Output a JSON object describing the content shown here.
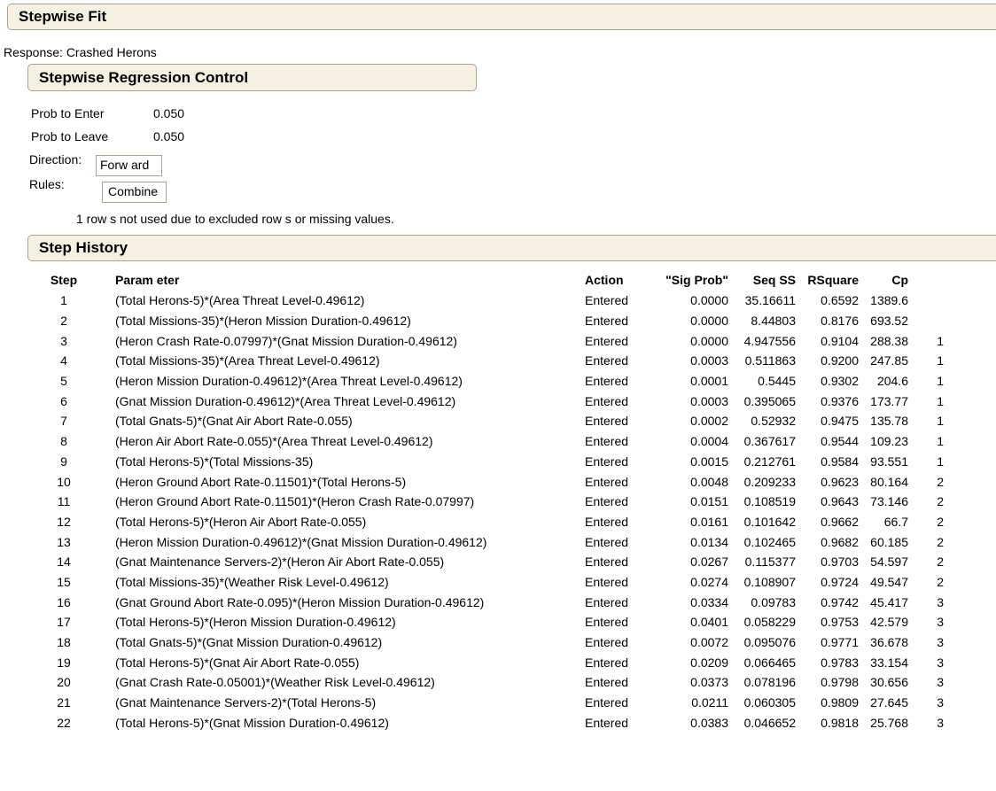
{
  "report": {
    "title": "Stepwise Fit",
    "response": "Response: Crashed Herons"
  },
  "control": {
    "title": "Stepwise Regression Control",
    "prob_enter_label": "Prob to Enter",
    "prob_enter_value": "0.050",
    "prob_leave_label": "Prob to Leave",
    "prob_leave_value": "0.050",
    "direction_label": "Direction:",
    "direction_value": "Forw ard",
    "rules_label": "Rules:",
    "rules_value": "Combine",
    "note": "1 row s not used due to excluded row s or missing values."
  },
  "history": {
    "title": "Step History",
    "columns": [
      "Step",
      "Param eter",
      "Action",
      "\"Sig Prob\"",
      "Seq SS",
      "RSquare",
      "Cp",
      ""
    ],
    "rows": [
      {
        "step": "1",
        "param": "(Total Herons-5)*(Area Threat Level-0.49612)",
        "action": "Entered",
        "sig": "0.0000",
        "seq": "35.16611",
        "rsq": "0.6592",
        "cp": "1389.6",
        "p": ""
      },
      {
        "step": "2",
        "param": "(Total Missions-35)*(Heron Mission Duration-0.49612)",
        "action": "Entered",
        "sig": "0.0000",
        "seq": "8.44803",
        "rsq": "0.8176",
        "cp": "693.52",
        "p": ""
      },
      {
        "step": "3",
        "param": "(Heron Crash Rate-0.07997)*(Gnat Mission Duration-0.49612)",
        "action": "Entered",
        "sig": "0.0000",
        "seq": "4.947556",
        "rsq": "0.9104",
        "cp": "288.38",
        "p": "1"
      },
      {
        "step": "4",
        "param": "(Total Missions-35)*(Area Threat Level-0.49612)",
        "action": "Entered",
        "sig": "0.0003",
        "seq": "0.511863",
        "rsq": "0.9200",
        "cp": "247.85",
        "p": "1"
      },
      {
        "step": "5",
        "param": "(Heron Mission Duration-0.49612)*(Area Threat Level-0.49612)",
        "action": "Entered",
        "sig": "0.0001",
        "seq": "0.5445",
        "rsq": "0.9302",
        "cp": "204.6",
        "p": "1"
      },
      {
        "step": "6",
        "param": "(Gnat Mission Duration-0.49612)*(Area Threat Level-0.49612)",
        "action": "Entered",
        "sig": "0.0003",
        "seq": "0.395065",
        "rsq": "0.9376",
        "cp": "173.77",
        "p": "1"
      },
      {
        "step": "7",
        "param": "(Total Gnats-5)*(Gnat Air Abort Rate-0.055)",
        "action": "Entered",
        "sig": "0.0002",
        "seq": "0.52932",
        "rsq": "0.9475",
        "cp": "135.78",
        "p": "1"
      },
      {
        "step": "8",
        "param": "(Heron Air Abort Rate-0.055)*(Area Threat Level-0.49612)",
        "action": "Entered",
        "sig": "0.0004",
        "seq": "0.367617",
        "rsq": "0.9544",
        "cp": "109.23",
        "p": "1"
      },
      {
        "step": "9",
        "param": "(Total Herons-5)*(Total Missions-35)",
        "action": "Entered",
        "sig": "0.0015",
        "seq": "0.212761",
        "rsq": "0.9584",
        "cp": "93.551",
        "p": "1"
      },
      {
        "step": "10",
        "param": "(Heron Ground Abort Rate-0.11501)*(Total Herons-5)",
        "action": "Entered",
        "sig": "0.0048",
        "seq": "0.209233",
        "rsq": "0.9623",
        "cp": "80.164",
        "p": "2"
      },
      {
        "step": "11",
        "param": "(Heron Ground Abort Rate-0.11501)*(Heron Crash Rate-0.07997)",
        "action": "Entered",
        "sig": "0.0151",
        "seq": "0.108519",
        "rsq": "0.9643",
        "cp": "73.146",
        "p": "2"
      },
      {
        "step": "12",
        "param": "(Total Herons-5)*(Heron Air Abort Rate-0.055)",
        "action": "Entered",
        "sig": "0.0161",
        "seq": "0.101642",
        "rsq": "0.9662",
        "cp": "66.7",
        "p": "2"
      },
      {
        "step": "13",
        "param": "(Heron Mission Duration-0.49612)*(Gnat Mission Duration-0.49612)",
        "action": "Entered",
        "sig": "0.0134",
        "seq": "0.102465",
        "rsq": "0.9682",
        "cp": "60.185",
        "p": "2"
      },
      {
        "step": "14",
        "param": "(Gnat Maintenance Servers-2)*(Heron Air Abort Rate-0.055)",
        "action": "Entered",
        "sig": "0.0267",
        "seq": "0.115377",
        "rsq": "0.9703",
        "cp": "54.597",
        "p": "2"
      },
      {
        "step": "15",
        "param": "(Total Missions-35)*(Weather Risk Level-0.49612)",
        "action": "Entered",
        "sig": "0.0274",
        "seq": "0.108907",
        "rsq": "0.9724",
        "cp": "49.547",
        "p": "2"
      },
      {
        "step": "16",
        "param": "(Gnat Ground Abort Rate-0.095)*(Heron Mission Duration-0.49612)",
        "action": "Entered",
        "sig": "0.0334",
        "seq": "0.09783",
        "rsq": "0.9742",
        "cp": "45.417",
        "p": "3"
      },
      {
        "step": "17",
        "param": "(Total Herons-5)*(Heron Mission Duration-0.49612)",
        "action": "Entered",
        "sig": "0.0401",
        "seq": "0.058229",
        "rsq": "0.9753",
        "cp": "42.579",
        "p": "3"
      },
      {
        "step": "18",
        "param": "(Total Gnats-5)*(Gnat Mission Duration-0.49612)",
        "action": "Entered",
        "sig": "0.0072",
        "seq": "0.095076",
        "rsq": "0.9771",
        "cp": "36.678",
        "p": "3"
      },
      {
        "step": "19",
        "param": "(Total Herons-5)*(Gnat Air Abort Rate-0.055)",
        "action": "Entered",
        "sig": "0.0209",
        "seq": "0.066465",
        "rsq": "0.9783",
        "cp": "33.154",
        "p": "3"
      },
      {
        "step": "20",
        "param": "(Gnat Crash Rate-0.05001)*(Weather Risk Level-0.49612)",
        "action": "Entered",
        "sig": "0.0373",
        "seq": "0.078196",
        "rsq": "0.9798",
        "cp": "30.656",
        "p": "3"
      },
      {
        "step": "21",
        "param": "(Gnat Maintenance Servers-2)*(Total Herons-5)",
        "action": "Entered",
        "sig": "0.0211",
        "seq": "0.060305",
        "rsq": "0.9809",
        "cp": "27.645",
        "p": "3"
      },
      {
        "step": "22",
        "param": "(Total Herons-5)*(Gnat Mission Duration-0.49612)",
        "action": "Entered",
        "sig": "0.0383",
        "seq": "0.046652",
        "rsq": "0.9818",
        "cp": "25.768",
        "p": "3"
      }
    ]
  }
}
